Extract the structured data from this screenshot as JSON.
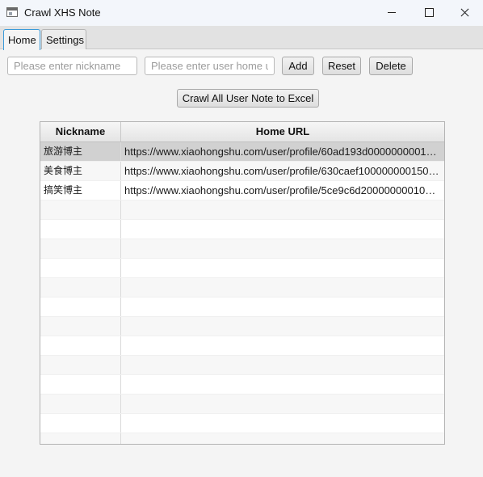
{
  "window": {
    "title": "Crawl XHS Note"
  },
  "tabs": [
    {
      "label": "Home",
      "active": true
    },
    {
      "label": "Settings",
      "active": false
    }
  ],
  "form": {
    "nickname_placeholder": "Please enter nickname",
    "nickname_value": "",
    "url_placeholder": "Please enter user home url",
    "url_value": "",
    "add_label": "Add",
    "reset_label": "Reset",
    "delete_label": "Delete",
    "crawl_label": "Crawl All User Note to Excel"
  },
  "table": {
    "columns": [
      "Nickname",
      "Home URL"
    ],
    "rows": [
      {
        "nickname": "旅游博主",
        "url": "https://www.xiaohongshu.com/user/profile/60ad193d0000000001…",
        "selected": true
      },
      {
        "nickname": "美食博主",
        "url": "https://www.xiaohongshu.com/user/profile/630caef100000000150…",
        "selected": false
      },
      {
        "nickname": "搞笑博主",
        "url": "https://www.xiaohongshu.com/user/profile/5ce9c6d20000000010…",
        "selected": false
      }
    ]
  },
  "icons": {
    "app": "app-window-icon",
    "minimize": "minimize-icon",
    "maximize": "maximize-icon",
    "close": "close-icon"
  },
  "colors": {
    "tab_focus_border": "#3a9ad9",
    "selected_row": "#d1d1d1",
    "background": "#f4f4f4"
  }
}
